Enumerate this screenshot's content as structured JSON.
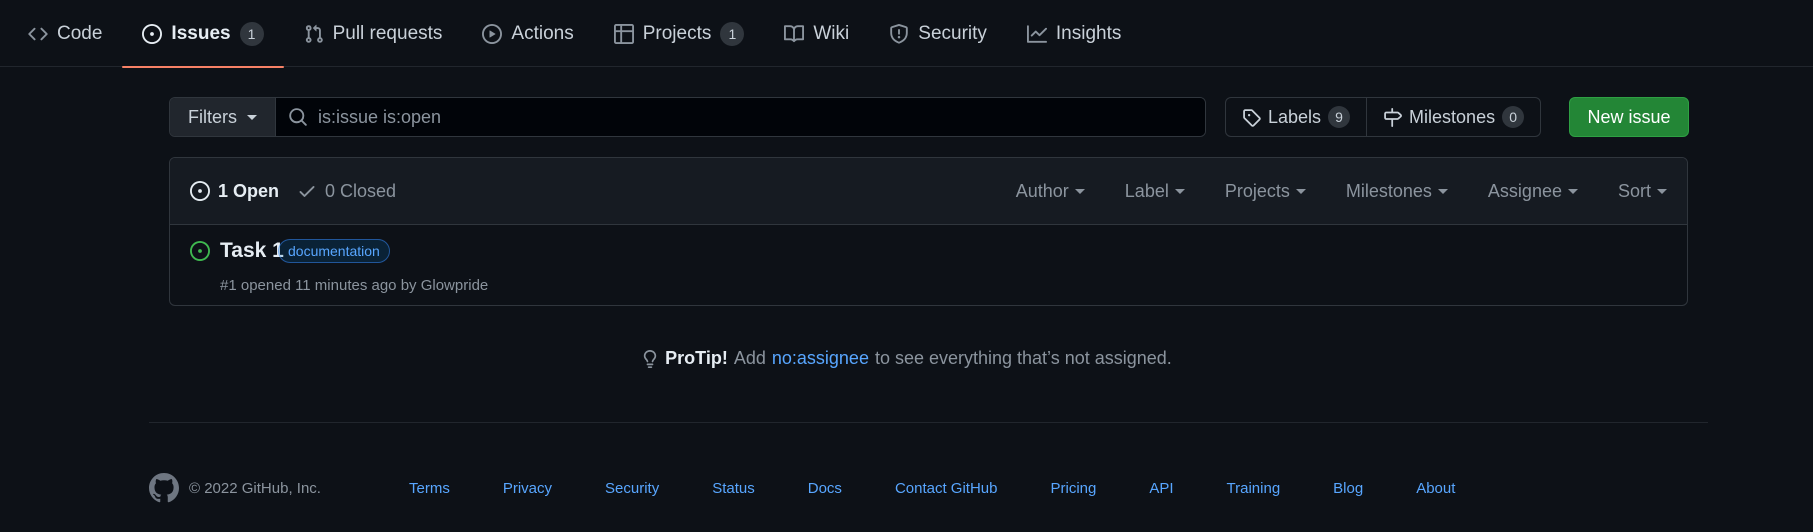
{
  "repo_nav": {
    "tabs": [
      {
        "label": "Code",
        "icon": "code-icon"
      },
      {
        "label": "Issues",
        "icon": "issue-opened-icon",
        "count": "1",
        "active": true
      },
      {
        "label": "Pull requests",
        "icon": "git-pull-request-icon"
      },
      {
        "label": "Actions",
        "icon": "play-icon"
      },
      {
        "label": "Projects",
        "icon": "table-icon",
        "count": "1"
      },
      {
        "label": "Wiki",
        "icon": "book-icon"
      },
      {
        "label": "Security",
        "icon": "shield-icon"
      },
      {
        "label": "Insights",
        "icon": "graph-icon"
      }
    ]
  },
  "subnav": {
    "filters_label": "Filters",
    "search_value": "is:issue is:open",
    "labels": {
      "label": "Labels",
      "count": "9"
    },
    "milestones": {
      "label": "Milestones",
      "count": "0"
    },
    "new_issue_label": "New issue"
  },
  "issues_box": {
    "open_label": "1 Open",
    "closed_label": "0 Closed",
    "filters": [
      "Author",
      "Label",
      "Projects",
      "Milestones",
      "Assignee",
      "Sort"
    ],
    "issues": [
      {
        "title": "Task 1",
        "label": "documentation",
        "label_color": "#0075ca",
        "meta_prefix": "#1 opened 11 minutes ago by ",
        "author": "Glowpride"
      }
    ]
  },
  "protip": {
    "bold": "ProTip!",
    "before": "Add",
    "link": "no:assignee",
    "after": "to see everything that’s not assigned."
  },
  "footer": {
    "copyright": "© 2022 GitHub, Inc.",
    "links": [
      "Terms",
      "Privacy",
      "Security",
      "Status",
      "Docs",
      "Contact GitHub",
      "Pricing",
      "API",
      "Training",
      "Blog",
      "About"
    ]
  },
  "colors": {
    "background": "#0d1117",
    "accent_link": "#58a6ff",
    "primary_button": "#238636",
    "active_tab_underline": "#f78166",
    "open_issue": "#3fb950"
  }
}
